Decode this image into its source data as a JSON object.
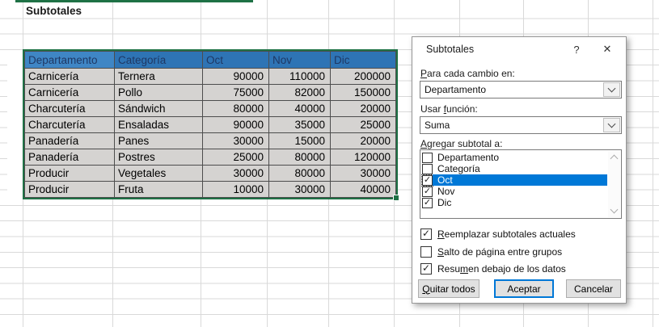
{
  "sheet": {
    "title_cell": "Subtotales",
    "table": {
      "headers": [
        "Departamento",
        "Categoría",
        "Oct",
        "Nov",
        "Dic"
      ],
      "rows": [
        [
          "Carnicería",
          "Ternera",
          "90000",
          "110000",
          "200000"
        ],
        [
          "Carnicería",
          "Pollo",
          "75000",
          "82000",
          "150000"
        ],
        [
          "Charcutería",
          "Sándwich",
          "80000",
          "40000",
          "20000"
        ],
        [
          "Charcutería",
          "Ensaladas",
          "90000",
          "35000",
          "25000"
        ],
        [
          "Panadería",
          "Panes",
          "30000",
          "15000",
          "20000"
        ],
        [
          "Panadería",
          "Postres",
          "25000",
          "80000",
          "120000"
        ],
        [
          "Producir",
          "Vegetales",
          "30000",
          "80000",
          "30000"
        ],
        [
          "Producir",
          "Fruta",
          "10000",
          "30000",
          "40000"
        ]
      ]
    },
    "colors": {
      "header_bg": "#2E74B5",
      "header_active_bg": "#3F86C5",
      "header_text": "#1F3864",
      "row_bg": "#D5D3D1",
      "selection_border": "#1E7145",
      "gridline": "#D9D9D9"
    }
  },
  "dialog": {
    "title": "Subtotales",
    "help_glyph": "?",
    "close_glyph": "✕",
    "accent": "#0078D7",
    "change_field": {
      "label": {
        "text": "Para cada cambio en:",
        "mnemonic": "P"
      },
      "value": "Departamento"
    },
    "function_field": {
      "label": {
        "text": "Usar función:",
        "mnemonic": "f"
      },
      "value": "Suma"
    },
    "list": {
      "label": {
        "text": "Agregar subtotal a:",
        "mnemonic": "A"
      },
      "items": [
        {
          "label": "Departamento",
          "checked": false,
          "selected": false
        },
        {
          "label": "Categoría",
          "checked": false,
          "selected": false
        },
        {
          "label": "Oct",
          "checked": true,
          "selected": true
        },
        {
          "label": "Nov",
          "checked": true,
          "selected": false
        },
        {
          "label": "Dic",
          "checked": true,
          "selected": false
        }
      ]
    },
    "options": [
      {
        "label": {
          "text": "Reemplazar subtotales actuales",
          "mnemonic": "R"
        },
        "checked": true
      },
      {
        "label": {
          "text": "Salto de página entre grupos",
          "mnemonic": "S"
        },
        "checked": false
      },
      {
        "label": {
          "text": "Resumen debajo de los datos",
          "mnemonic": "m"
        },
        "checked": true
      }
    ],
    "buttons": [
      {
        "label": {
          "text": "Quitar todos",
          "mnemonic": "Q"
        },
        "default": false
      },
      {
        "label": {
          "text": "Aceptar",
          "mnemonic": ""
        },
        "default": true
      },
      {
        "label": {
          "text": "Cancelar",
          "mnemonic": ""
        },
        "default": false
      }
    ],
    "check_glyph": "✓"
  }
}
